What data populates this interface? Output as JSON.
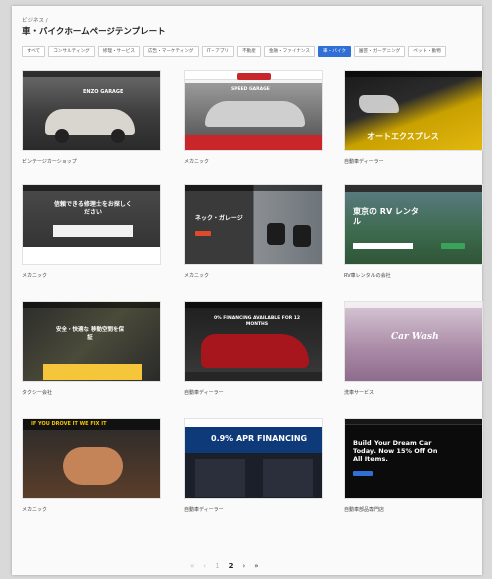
{
  "breadcrumb": "ビジネス /",
  "page_title": "車・バイクホームページテンプレート",
  "filters": [
    {
      "label": "すべて",
      "active": false
    },
    {
      "label": "コンサルティング",
      "active": false
    },
    {
      "label": "修理・サービス",
      "active": false
    },
    {
      "label": "広告・マーケティング",
      "active": false
    },
    {
      "label": "IT・アプリ",
      "active": false
    },
    {
      "label": "不動産",
      "active": false
    },
    {
      "label": "金融・ファイナンス",
      "active": false
    },
    {
      "label": "車・バイク",
      "active": true
    },
    {
      "label": "園芸・ガーデニング",
      "active": false
    },
    {
      "label": "ペット・動物",
      "active": false
    }
  ],
  "templates": [
    {
      "label": "ビンテージカーショップ",
      "thumb_text": "ENZO GARAGE"
    },
    {
      "label": "メカニック",
      "thumb_text": "SPEED GARAGE"
    },
    {
      "label": "自動車ディーラー",
      "thumb_text": "オートエクスプレス"
    },
    {
      "label": "メカニック",
      "thumb_text": "信頼できる修理士をお探しください"
    },
    {
      "label": "メカニック",
      "thumb_text": "ネック・ガレージ"
    },
    {
      "label": "RV車レンタルの会社",
      "thumb_text": "東京の RV レンタル"
    },
    {
      "label": "タクシー会社",
      "thumb_text": "安全・快適な 移動空間を保証"
    },
    {
      "label": "自動車ディーラー",
      "thumb_text": "0% FINANCING AVAILABLE FOR 12 MONTHS"
    },
    {
      "label": "洗車サービス",
      "thumb_text": "Car Wash"
    },
    {
      "label": "メカニック",
      "thumb_text": "IF YOU DROVE IT WE FIX IT"
    },
    {
      "label": "自動車ディーラー",
      "thumb_text": "0.9% APR FINANCING"
    },
    {
      "label": "自動車部品専門店",
      "thumb_text": "Build Your Dream Car Today. Now 15% Off On All Items."
    }
  ],
  "pagination": {
    "first": "«",
    "prev": "‹",
    "page1": "1",
    "current": "2",
    "next": "›",
    "last": "»"
  }
}
